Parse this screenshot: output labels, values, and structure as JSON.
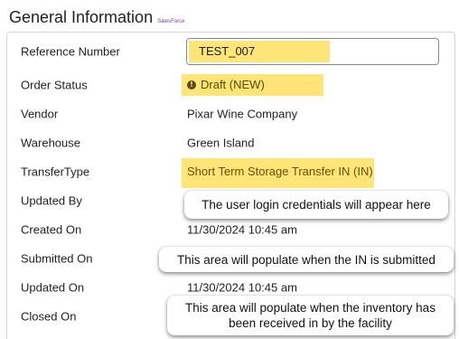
{
  "header": {
    "title": "General Information",
    "source": "SalesForce"
  },
  "fields": {
    "reference_number": {
      "label": "Reference Number",
      "value": "TEST_007"
    },
    "order_status": {
      "label": "Order Status",
      "value": "Draft (NEW)",
      "icon": "info-icon"
    },
    "vendor": {
      "label": "Vendor",
      "value": "Pixar Wine Company"
    },
    "warehouse": {
      "label": "Warehouse",
      "value": "Green Island"
    },
    "transfer_type": {
      "label": "TransferType",
      "value": "Short Term Storage Transfer IN (IN)"
    },
    "updated_by": {
      "label": "Updated By",
      "value": ""
    },
    "created_on": {
      "label": "Created On",
      "value": "11/30/2024 10:45 am"
    },
    "submitted_on": {
      "label": "Submitted On",
      "value": ""
    },
    "updated_on": {
      "label": "Updated On",
      "value": "11/30/2024 10:45 am"
    },
    "closed_on": {
      "label": "Closed On",
      "value": ""
    }
  },
  "callouts": {
    "updated_by_note": "The user login credentials will appear here",
    "submitted_on_note": "This area will populate when the IN is submitted",
    "closed_on_note_line1": "This area will populate when the inventory has",
    "closed_on_note_line2": "been received in by the facility"
  },
  "colors": {
    "highlight": "#ffe477",
    "source_tag": "#7a3b91"
  }
}
